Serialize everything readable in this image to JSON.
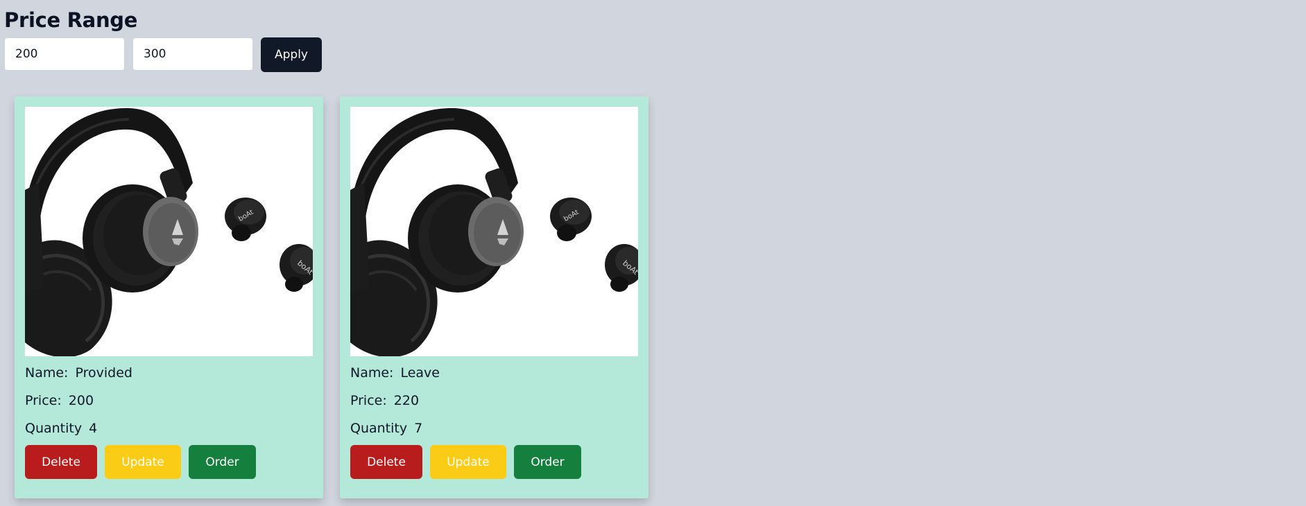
{
  "filter": {
    "title": "Price Range",
    "min_value": "200",
    "max_value": "300",
    "apply_label": "Apply"
  },
  "products": [
    {
      "name_label": "Name:",
      "name": "Provided",
      "price_label": "Price:",
      "price": "200",
      "quantity_label": "Quantity",
      "quantity": "4",
      "image_icon": "headphones-earbuds-icon",
      "buttons": {
        "delete": "Delete",
        "update": "Update",
        "order": "Order"
      }
    },
    {
      "name_label": "Name:",
      "name": "Leave",
      "price_label": "Price:",
      "price": "220",
      "quantity_label": "Quantity",
      "quantity": "7",
      "image_icon": "headphones-earbuds-icon",
      "buttons": {
        "delete": "Delete",
        "update": "Update",
        "order": "Order"
      }
    }
  ],
  "colors": {
    "page_background": "#d1d5dd",
    "card_background": "#b4e9d9",
    "apply_button": "#111827",
    "delete_button": "#b91c1c",
    "update_button": "#facc15",
    "order_button": "#15803d"
  }
}
